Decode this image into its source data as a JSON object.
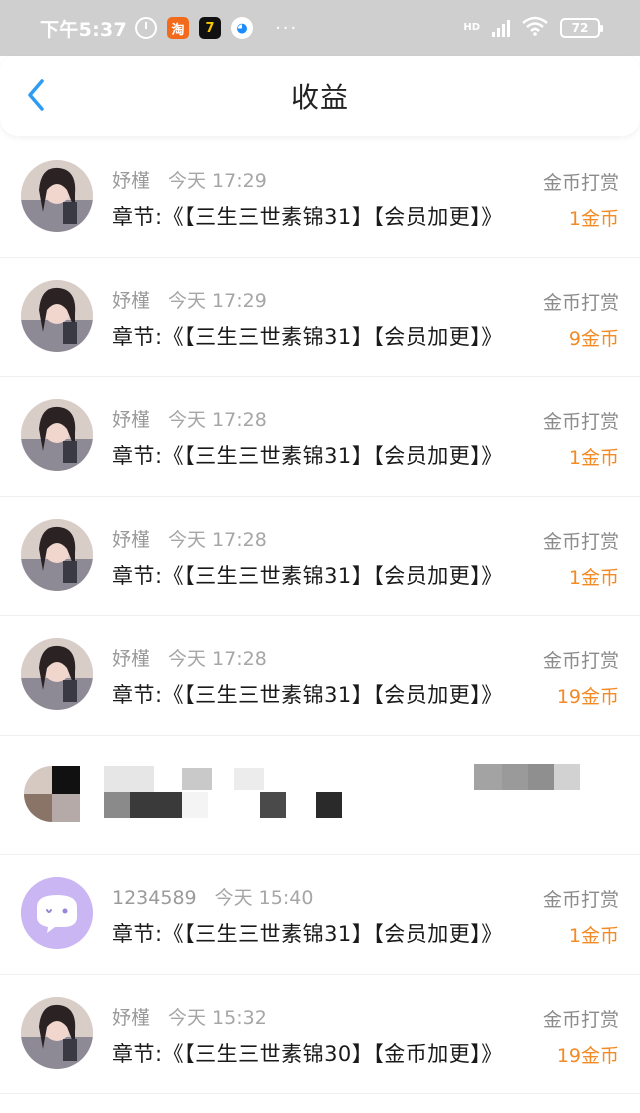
{
  "status_bar": {
    "time": "下午5:37",
    "hd": "HD",
    "battery": "72",
    "dots": "···"
  },
  "header": {
    "title": "收益"
  },
  "rows": [
    {
      "name": "妤槿",
      "time": "今天 17:29",
      "chapter": "章节:《【三生三世素锦31】【会员加更】》",
      "type": "金币打赏",
      "amount": "1金币",
      "avatar": "photo"
    },
    {
      "name": "妤槿",
      "time": "今天 17:29",
      "chapter": "章节:《【三生三世素锦31】【会员加更】》",
      "type": "金币打赏",
      "amount": "9金币",
      "avatar": "photo"
    },
    {
      "name": "妤槿",
      "time": "今天 17:28",
      "chapter": "章节:《【三生三世素锦31】【会员加更】》",
      "type": "金币打赏",
      "amount": "1金币",
      "avatar": "photo"
    },
    {
      "name": "妤槿",
      "time": "今天 17:28",
      "chapter": "章节:《【三生三世素锦31】【会员加更】》",
      "type": "金币打赏",
      "amount": "1金币",
      "avatar": "photo"
    },
    {
      "name": "妤槿",
      "time": "今天 17:28",
      "chapter": "章节:《【三生三世素锦31】【会员加更】》",
      "type": "金币打赏",
      "amount": "19金币",
      "avatar": "photo"
    },
    {
      "redacted": true
    },
    {
      "name": "1234589",
      "time": "今天 15:40",
      "chapter": "章节:《【三生三世素锦31】【会员加更】》",
      "type": "金币打赏",
      "amount": "1金币",
      "avatar": "default"
    },
    {
      "name": "妤槿",
      "time": "今天 15:32",
      "chapter": "章节:《【三生三世素锦30】【金币加更】》",
      "type": "金币打赏",
      "amount": "19金币",
      "avatar": "photo"
    }
  ],
  "colors": {
    "amount": "#f28a25",
    "back_arrow": "#2f9cf3",
    "status_bar_bg": "#cfcfcf",
    "default_avatar_bg": "#c9b6f2"
  }
}
